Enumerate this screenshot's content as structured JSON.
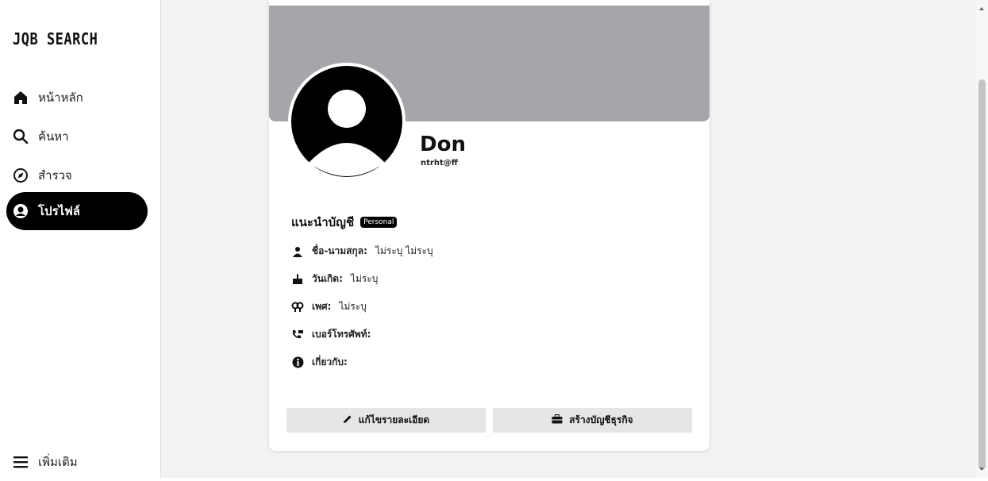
{
  "sidebar": {
    "logo": "JQB SEARCH",
    "items": [
      {
        "label": "หน้าหลัก",
        "icon": "home-icon"
      },
      {
        "label": "ค้นหา",
        "icon": "search-icon"
      },
      {
        "label": "สำรวจ",
        "icon": "compass-icon"
      },
      {
        "label": "โปรไฟล์",
        "icon": "profile-icon",
        "active": true
      }
    ],
    "more_label": "เพิ่มเติม",
    "more_icon": "menu-icon"
  },
  "profile": {
    "name": "Don",
    "email": "ntrht@ff",
    "about_title": "แนะนำบัญชี",
    "account_badge": "Personal",
    "fields": {
      "name_label": "ชื่อ-นามสกุล:",
      "name_value": "ไม่ระบุ  ไม่ระบุ",
      "birthday_label": "วันเกิด:",
      "birthday_value": "ไม่ระบุ",
      "gender_label": "เพศ:",
      "gender_value": "ไม่ระบุ",
      "phone_label": "เบอร์โทรศัพท์:",
      "phone_value": "",
      "about_label": "เกี่ยวกับ:",
      "about_value": ""
    },
    "buttons": {
      "edit_label": "แก้ไขรายละเอียด",
      "business_label": "สร้างบัญชีธุรกิจ"
    }
  },
  "colors": {
    "cover": "#a6a5a9",
    "active_nav_bg": "#000000",
    "main_bg": "#f2f2f2",
    "button_bg": "#e6e6e6"
  }
}
